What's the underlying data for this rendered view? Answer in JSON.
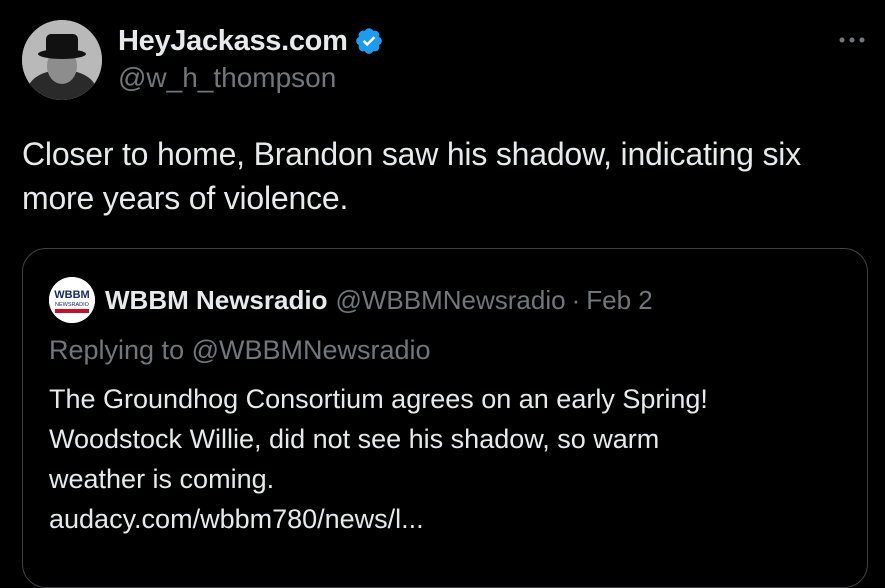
{
  "tweet": {
    "display_name": "HeyJackass.com",
    "handle": "@w_h_thompson",
    "more_icon": "more-horizontal-icon",
    "verified_icon": "verified-badge-icon",
    "text": "Closer to home, Brandon saw his shadow, indicating six more years of violence."
  },
  "quote": {
    "avatar_text": [
      "WBBM",
      "NEWSRADIO"
    ],
    "display_name": "WBBM Newsradio",
    "handle": "@WBBMNewsradio",
    "separator": "·",
    "date": "Feb 2",
    "replying_label": "Replying to",
    "replying_handle": "@WBBMNewsradio",
    "body_lines": [
      "The Groundhog Consortium agrees on an early Spring!",
      "Woodstock Willie, did not see his shadow, so warm",
      "weather is coming.",
      "audacy.com/wbbm780/news/l..."
    ]
  },
  "colors": {
    "background": "#000000",
    "text_primary": "#e7e9ea",
    "text_secondary": "#71767b",
    "verified": "#1d9bf0",
    "border": "#3e4144"
  }
}
